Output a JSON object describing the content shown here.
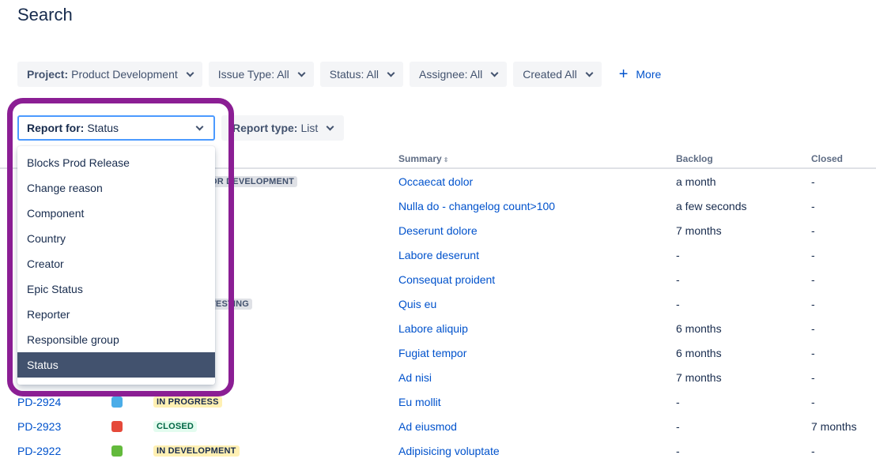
{
  "page": {
    "title": "Search"
  },
  "filters": [
    {
      "key": "Project:",
      "value": "Product Development"
    },
    {
      "key": "",
      "value": "Issue Type: All"
    },
    {
      "key": "",
      "value": "Status: All"
    },
    {
      "key": "",
      "value": "Assignee: All"
    },
    {
      "key": "",
      "value": "Created All"
    }
  ],
  "more_label": "More",
  "report_for": {
    "key": "Report for:",
    "value": "Status"
  },
  "report_type": {
    "key": "Report type:",
    "value": "List"
  },
  "dropdown": {
    "items": [
      "Blocks Prod Release",
      "Change reason",
      "Component",
      "Country",
      "Creator",
      "Epic Status",
      "Reporter",
      "Responsible group",
      "Status"
    ],
    "selected": "Status"
  },
  "table": {
    "headers": {
      "summary": "Summary",
      "backlog": "Backlog",
      "closed": "Closed"
    },
    "rows": [
      {
        "key": "",
        "status": "OR DEVELOPMENT",
        "summary": "Occaecat dolor",
        "backlog": "a month",
        "closed": "-"
      },
      {
        "key": "",
        "status": "",
        "summary": "Nulla do - changelog count>100",
        "backlog": "a few seconds",
        "closed": "-"
      },
      {
        "key": "",
        "status": "",
        "summary": "Deserunt dolore",
        "backlog": "7 months",
        "closed": "-"
      },
      {
        "key": "",
        "status": "",
        "summary": "Labore deserunt",
        "backlog": "-",
        "closed": "-"
      },
      {
        "key": "",
        "status": "",
        "summary": "Consequat proident",
        "backlog": "-",
        "closed": "-"
      },
      {
        "key": "",
        "status": "TESTING",
        "summary": "Quis eu",
        "backlog": "-",
        "closed": "-"
      },
      {
        "key": "",
        "status": "",
        "summary": "Labore aliquip",
        "backlog": "6 months",
        "closed": "-"
      },
      {
        "key": "",
        "status": "",
        "summary": "Fugiat tempor",
        "backlog": "6 months",
        "closed": "-"
      },
      {
        "key": "",
        "status": "",
        "summary": "Ad nisi",
        "backlog": "7 months",
        "closed": "-"
      },
      {
        "key": "PD-2924",
        "status": "IN PROGRESS",
        "summary": "Eu mollit",
        "backlog": "-",
        "closed": "-"
      },
      {
        "key": "PD-2923",
        "status": "CLOSED",
        "summary": "Ad eiusmod",
        "backlog": "-",
        "closed": "7 months"
      },
      {
        "key": "PD-2922",
        "status": "IN DEVELOPMENT",
        "summary": "Adipisicing voluptate",
        "backlog": "-",
        "closed": "-"
      }
    ]
  },
  "colors": {
    "accent": "#0052cc",
    "highlight": "#8b1e94",
    "selected_bg": "#42526e",
    "in_progress_bg": "#fff0b3",
    "closed_bg": "#e3fcef",
    "closed_fg": "#006644",
    "in_dev_bg": "#fff0b3",
    "testing_bg": "#dfe1e6"
  }
}
